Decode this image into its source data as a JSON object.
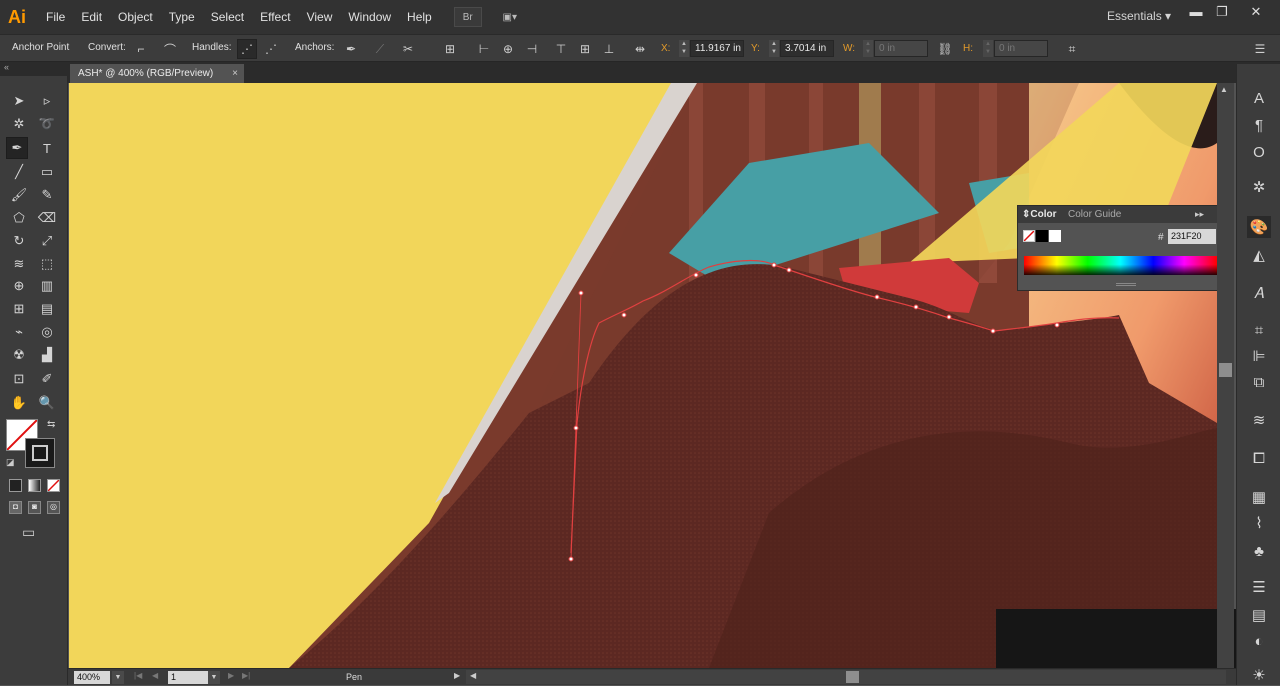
{
  "app": {
    "logo": "Ai",
    "workspace": "Essentials"
  },
  "menu": [
    "File",
    "Edit",
    "Object",
    "Type",
    "Select",
    "Effect",
    "View",
    "Window",
    "Help"
  ],
  "menubar_buttons": {
    "bridge": "Br",
    "arrange": "▣▾"
  },
  "window_controls": {
    "minimize": "▬",
    "restore": "❐",
    "close": "✕"
  },
  "control_bar": {
    "tool_name": "Anchor Point",
    "convert_label": "Convert:",
    "handles_label": "Handles:",
    "anchors_label": "Anchors:",
    "x_label": "X:",
    "x_value": "11.9167 in",
    "y_label": "Y:",
    "y_value": "3.7014 in",
    "w_label": "W:",
    "w_value": "0 in",
    "h_label": "H:",
    "h_value": "0 in"
  },
  "document": {
    "tab_title": "ASH* @ 400% (RGB/Preview)",
    "close": "×"
  },
  "status_bar": {
    "zoom": "400%",
    "artboard": "1",
    "tool": "Pen"
  },
  "color_panel": {
    "tabs": [
      "Color",
      "Color Guide"
    ],
    "hex_label": "#",
    "hex_value": "231F20"
  },
  "colors": {
    "canvas_yellow": "#f2d65a",
    "fabric_dark": "#5e2a22",
    "path_red": "#e04040",
    "accent_orange": "#e39b2a"
  },
  "icons": {
    "toolbar": [
      "selection-icon",
      "direct-selection-icon",
      "magic-wand-icon",
      "lasso-icon",
      "pen-icon",
      "type-icon",
      "line-icon",
      "rectangle-icon",
      "paintbrush-icon",
      "pencil-icon",
      "shaper-icon",
      "eraser-icon",
      "rotate-icon",
      "scale-icon",
      "warp-icon",
      "free-transform-icon",
      "shape-builder-icon",
      "perspective-icon",
      "mesh-icon",
      "gradient-icon",
      "eyedropper-icon",
      "blend-icon",
      "symbol-sprayer-icon",
      "graph-icon",
      "artboard-icon",
      "slice-icon",
      "hand-icon",
      "zoom-icon"
    ]
  }
}
